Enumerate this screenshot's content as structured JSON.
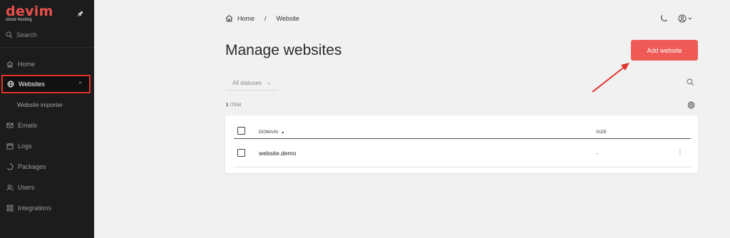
{
  "sidebar": {
    "logo_text": "devim",
    "logo_sub": "cloud hosting",
    "search_label": "Search",
    "items": [
      {
        "label": "Home",
        "icon": "home-icon"
      },
      {
        "label": "Websites",
        "icon": "globe-icon",
        "active": true
      },
      {
        "label": "Website importer"
      },
      {
        "label": "Emails",
        "icon": "mail-icon"
      },
      {
        "label": "Logs",
        "icon": "calendar-icon"
      },
      {
        "label": "Packages",
        "icon": "circle-icon"
      },
      {
        "label": "Users",
        "icon": "users-icon"
      },
      {
        "label": "Integrations",
        "icon": "grid-icon"
      }
    ]
  },
  "breadcrumb": {
    "home": "Home",
    "separator": "/",
    "current": "Website"
  },
  "page": {
    "title": "Manage websites",
    "add_button": "Add website",
    "status_filter": "All statuses",
    "item_count": "1",
    "item_label": "ITEM"
  },
  "table": {
    "columns": [
      "DOMAIN",
      "SIZE"
    ],
    "sort_indicator": "▲",
    "rows": [
      {
        "domain": "website.demo",
        "size": "-"
      }
    ]
  },
  "colors": {
    "accent": "#ef5a57",
    "sidebar_bg": "#1c1c1c",
    "highlight": "#e0332c"
  }
}
